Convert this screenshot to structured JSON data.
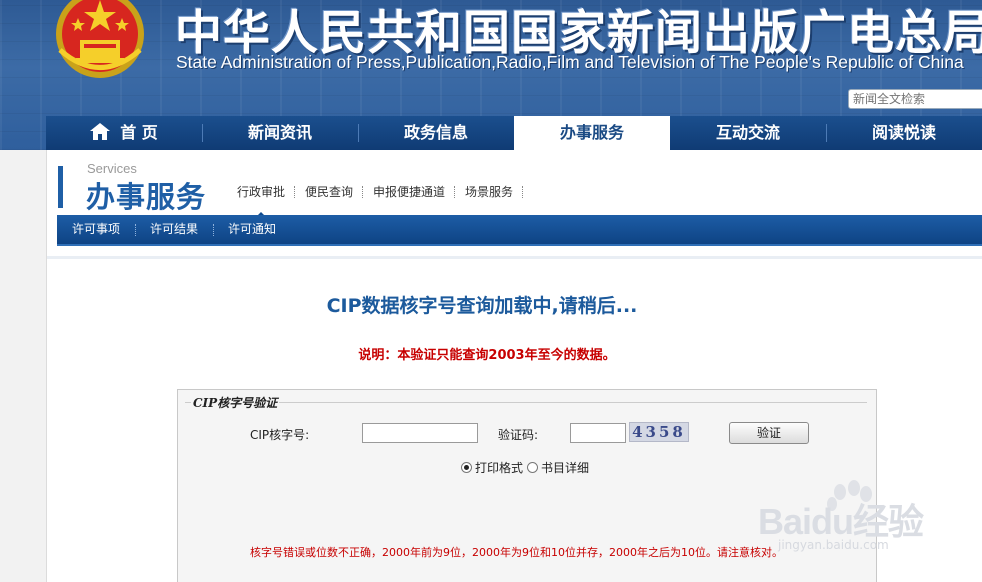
{
  "header": {
    "title_cn": "中华人民共和国国家新闻出版广电总局",
    "title_en": "State Administration of Press,Publication,Radio,Film and Television of The People's Republic of China",
    "search_placeholder": "新闻全文检索"
  },
  "main_nav": {
    "items": [
      {
        "label": "首 页"
      },
      {
        "label": "新闻资讯"
      },
      {
        "label": "政务信息"
      },
      {
        "label": "办事服务",
        "active": true
      },
      {
        "label": "互动交流"
      },
      {
        "label": "阅读悦读"
      }
    ]
  },
  "section": {
    "title_en": "Services",
    "title_cn": "办事服务",
    "sub_nav": [
      "行政审批",
      "便民查询",
      "申报便捷通道",
      "场景服务"
    ],
    "tertiary_nav": [
      "许可事项",
      "许可结果",
      "许可通知"
    ]
  },
  "main": {
    "loading_title": "CIP数据核字号查询加载中,请稍后...",
    "note": "说明：本验证只能查询2003年至今的数据。"
  },
  "form": {
    "legend": "CIP核字号验证",
    "cip_label": "CIP核字号:",
    "cip_value": "",
    "captcha_label": "验证码:",
    "captcha_value": "",
    "captcha_image_text": "4358",
    "submit_label": "验证",
    "radio_print": "打印格式",
    "radio_detail": "书目详细",
    "selected_radio": "打印格式",
    "error_text": "核字号错误或位数不正确，2000年前为9位，2000年为9位和10位并存，2000年之后为10位。请注意核对。"
  },
  "watermark": {
    "brand": "Baidu经验",
    "url": "jingyan.baidu.com"
  },
  "colors": {
    "nav_bg": "#0f3b74",
    "accent_blue": "#1f5fa6",
    "error_red": "#c70000"
  }
}
